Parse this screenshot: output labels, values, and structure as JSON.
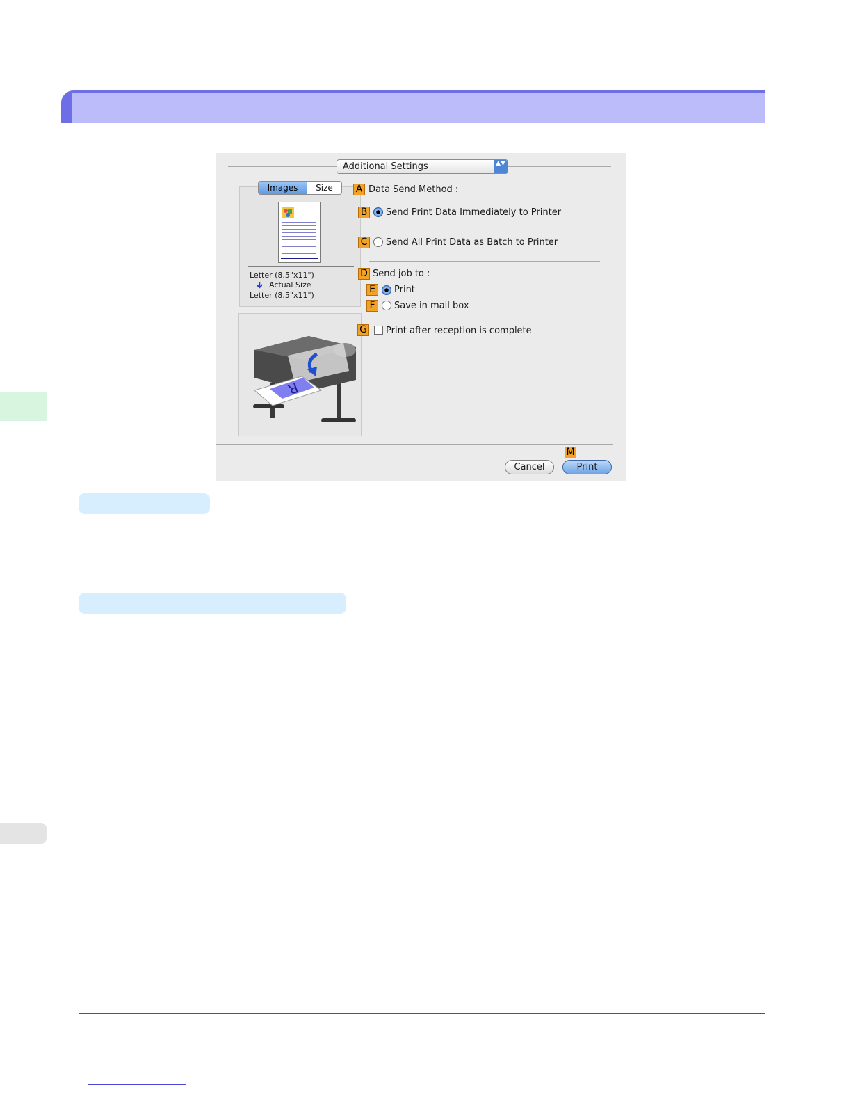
{
  "dialog": {
    "popup_label": "Additional Settings",
    "popup_arrows": "▲▼",
    "preview": {
      "tab_images": "Images",
      "tab_size": "Size",
      "selected_tab": "Images",
      "original_size": "Letter (8.5\"x11\")",
      "arrow": "🡻",
      "scaling": "Actual Size",
      "output_size": "Letter (8.5\"x11\")"
    },
    "data_send_method": {
      "marker": "A",
      "label": "Data Send Method :"
    },
    "send_immediately": {
      "marker": "B",
      "label": "Send Print Data Immediately to Printer",
      "selected": true
    },
    "send_batch": {
      "marker": "C",
      "label": "Send All Print Data as Batch to Printer",
      "selected": false
    },
    "send_job_to": {
      "marker": "D",
      "label": "Send job to :"
    },
    "job_print": {
      "marker": "E",
      "label": "Print",
      "selected": true
    },
    "job_mailbox": {
      "marker": "F",
      "label": "Save in mail box",
      "selected": false
    },
    "print_after_reception": {
      "marker": "G",
      "label": "Print after reception is complete",
      "checked": false
    },
    "print_marker": "M",
    "cancel_label": "Cancel",
    "print_label": "Print"
  },
  "colors": {
    "section_bar": "#bcbcfa",
    "section_accent": "#6e6ee6",
    "callout_marker": "#f2a227",
    "subheading_pill": "#d6eefe"
  }
}
